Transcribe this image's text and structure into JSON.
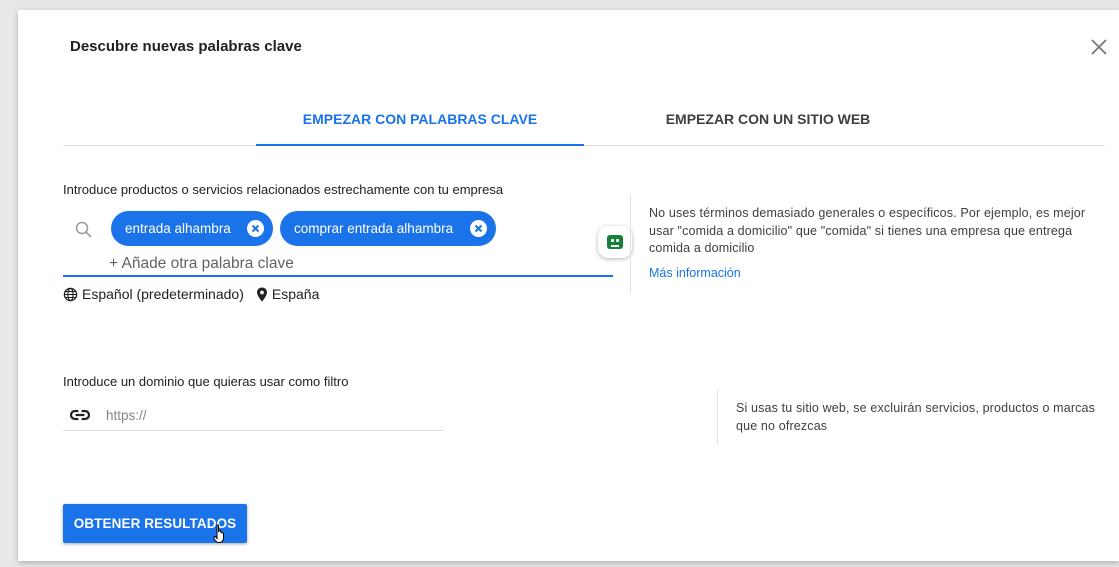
{
  "dialog": {
    "title": "Descubre nuevas palabras clave"
  },
  "tabs": [
    {
      "label": "EMPEZAR CON PALABRAS CLAVE",
      "active": true
    },
    {
      "label": "EMPEZAR CON UN SITIO WEB",
      "active": false
    }
  ],
  "keywords": {
    "label": "Introduce productos o servicios relacionados estrechamente con tu empresa",
    "chips": [
      {
        "text": "entrada alhambra"
      },
      {
        "text": "comprar entrada alhambra"
      }
    ],
    "add_placeholder": "+ Añade otra palabra clave",
    "language": "Español (predeterminado)",
    "location": "España"
  },
  "tip": {
    "text": "No uses términos demasiado generales o específicos. Por ejemplo, es mejor usar \"comida a domicilio\" que \"comida\" si tienes una empresa que entrega comida a domicilio",
    "link": "Más información"
  },
  "domain_filter": {
    "label": "Introduce un dominio que quieras usar como filtro",
    "placeholder": "https://",
    "note": "Si usas tu sitio web, se excluirán servicios, productos o marcas que no ofrezcas"
  },
  "actions": {
    "submit_label": "OBTENER RESULTADOS"
  },
  "colors": {
    "accent": "#1a73e8",
    "bot_green": "#188038"
  },
  "icons": {
    "close": "close-icon",
    "search": "search-icon",
    "chip_remove": "cancel-circle-icon",
    "globe": "globe-icon",
    "location": "location-pin-icon",
    "link": "link-icon",
    "assistant": "bot-icon",
    "pointer": "hand-pointer-icon"
  }
}
